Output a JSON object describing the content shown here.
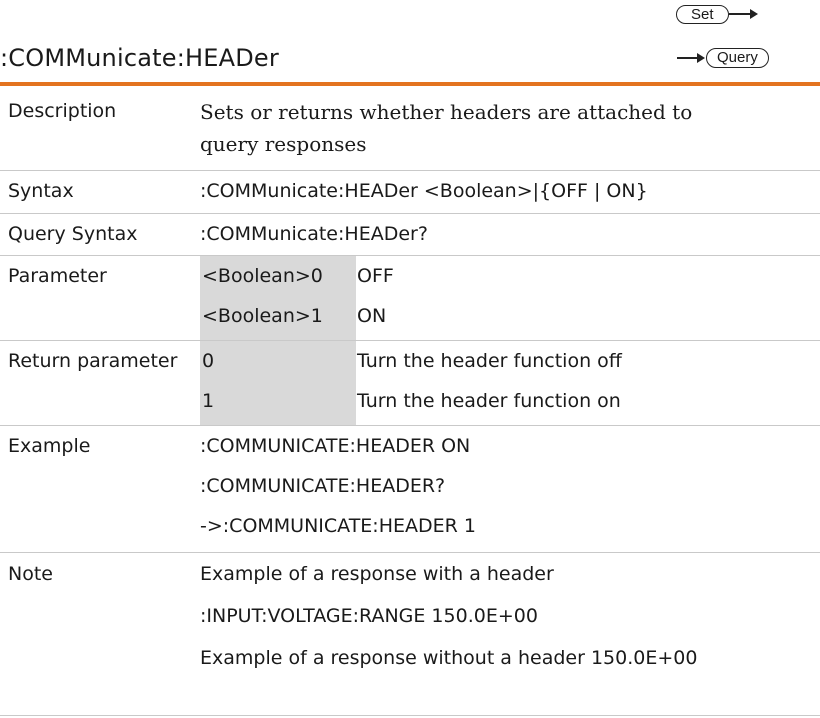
{
  "header": {
    "title": ":COMMunicate:HEADer",
    "set_badge": "Set",
    "query_badge": "Query"
  },
  "rows": {
    "description": {
      "label": "Description",
      "lines": [
        "Sets or returns whether headers are attached to",
        "query responses"
      ]
    },
    "syntax": {
      "label": "Syntax",
      "value": ":COMMunicate:HEADer <Boolean>|{OFF | ON}"
    },
    "query_syntax": {
      "label": "Query Syntax",
      "value": ":COMMunicate:HEADer?"
    },
    "parameter": {
      "label": "Parameter",
      "items": [
        {
          "param": "<Boolean>0",
          "value": "OFF"
        },
        {
          "param": "<Boolean>1",
          "value": "ON"
        }
      ]
    },
    "return_parameter": {
      "label": "Return parameter",
      "items": [
        {
          "param": "0",
          "value": "Turn the header function off"
        },
        {
          "param": "1",
          "value": "Turn the header function on"
        }
      ]
    },
    "example": {
      "label": "Example",
      "lines": [
        ":COMMUNICATE:HEADER ON",
        ":COMMUNICATE:HEADER?",
        "->:COMMUNICATE:HEADER 1"
      ]
    },
    "note": {
      "label": "Note",
      "lines": [
        "Example of a response with a header",
        ":INPUT:VOLTAGE:RANGE 150.0E+00",
        "Example of a response without a header 150.0E+00"
      ]
    }
  },
  "colors": {
    "accent": "#e3731f",
    "param_shade": "#d9d9d9",
    "separator": "#c9c9c9"
  }
}
